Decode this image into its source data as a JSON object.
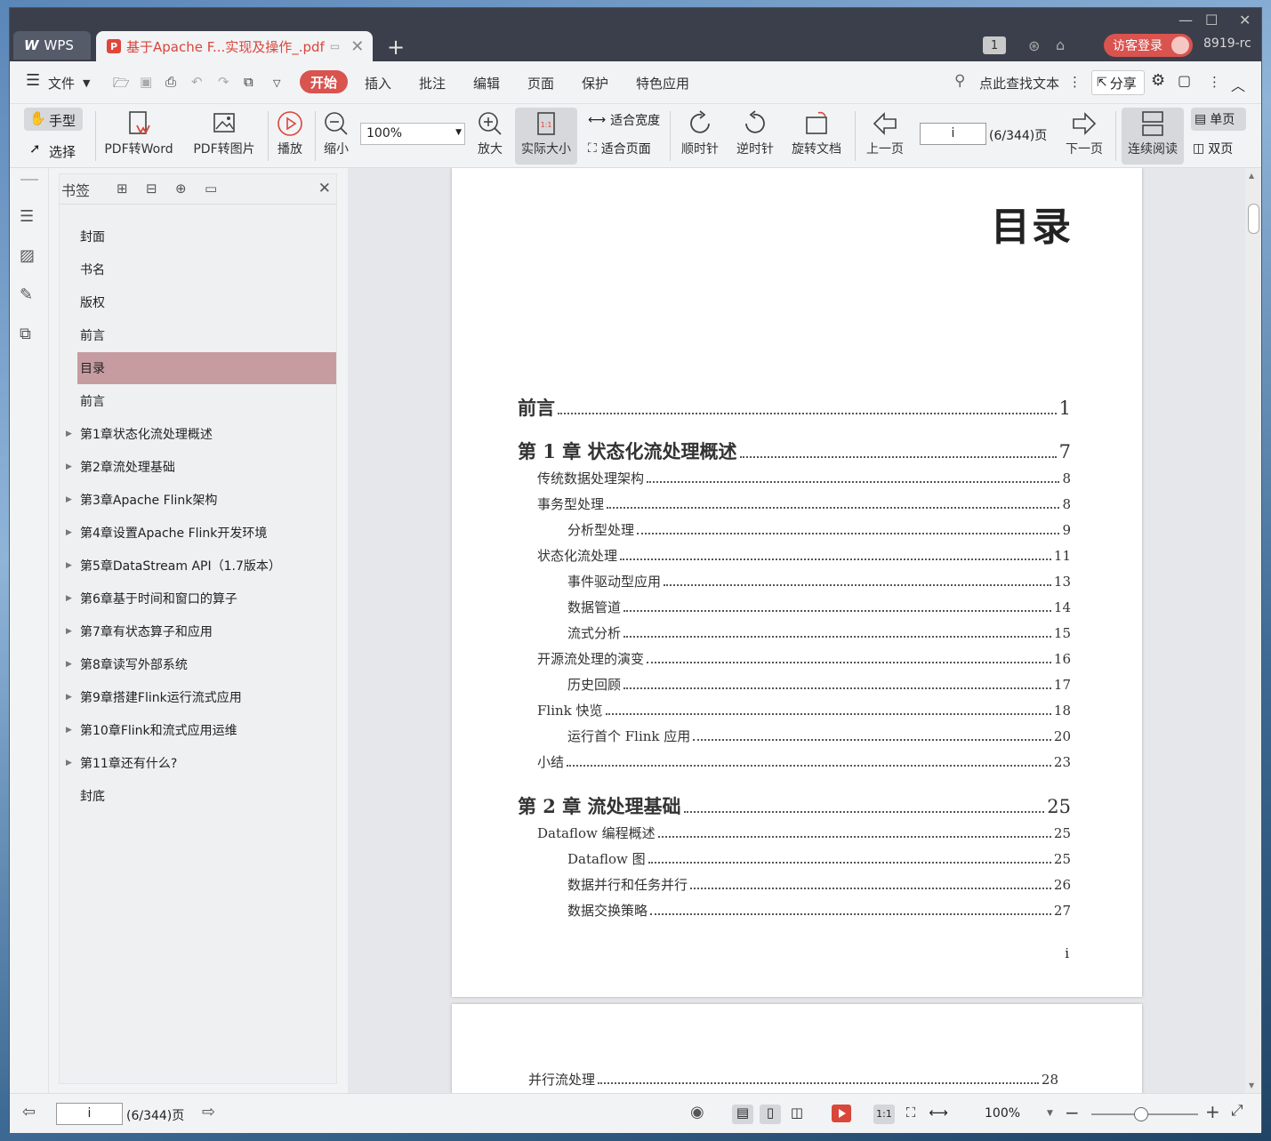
{
  "titlebar": {
    "app_tab": "WPS",
    "doc_tab": "基于Apache F...实现及操作_.pdf",
    "badge": "1",
    "visitor": "访客登录",
    "user": "8919-rc"
  },
  "menu": {
    "file": "文件",
    "start": "开始",
    "insert": "插入",
    "annotate": "批注",
    "edit": "编辑",
    "page": "页面",
    "protect": "保护",
    "special": "特色应用",
    "search": "点此查找文本",
    "share": "分享"
  },
  "ribbon": {
    "hand": "手型",
    "select": "选择",
    "pdf_word": "PDF转Word",
    "pdf_img": "PDF转图片",
    "play": "播放",
    "zoom_out": "缩小",
    "zoom_value": "100%",
    "zoom_in": "放大",
    "actual": "实际大小",
    "fit_width": "适合宽度",
    "fit_page": "适合页面",
    "cw": "顺时针",
    "ccw": "逆时针",
    "rotate": "旋转文档",
    "prev": "上一页",
    "page_input": "i",
    "page_count": "(6/344)页",
    "next": "下一页",
    "continuous": "连续阅读",
    "single": "单页",
    "double": "双页"
  },
  "bookmarks": {
    "title": "书签",
    "items": [
      {
        "label": "封面",
        "expandable": false
      },
      {
        "label": "书名",
        "expandable": false
      },
      {
        "label": "版权",
        "expandable": false
      },
      {
        "label": "前言",
        "expandable": false
      },
      {
        "label": "目录",
        "expandable": false,
        "active": true
      },
      {
        "label": "前言",
        "expandable": false
      },
      {
        "label": "第1章状态化流处理概述",
        "expandable": true
      },
      {
        "label": "第2章流处理基础",
        "expandable": true
      },
      {
        "label": "第3章Apache Flink架构",
        "expandable": true
      },
      {
        "label": "第4章设置Apache Flink开发环境",
        "expandable": true
      },
      {
        "label": "第5章DataStream API（1.7版本）",
        "expandable": true
      },
      {
        "label": "第6章基于时间和窗口的算子",
        "expandable": true
      },
      {
        "label": "第7章有状态算子和应用",
        "expandable": true
      },
      {
        "label": "第8章读写外部系统",
        "expandable": true
      },
      {
        "label": "第9章搭建Flink运行流式应用",
        "expandable": true
      },
      {
        "label": "第10章Flink和流式应用运维",
        "expandable": true
      },
      {
        "label": "第11章还有什么?",
        "expandable": true
      },
      {
        "label": "封底",
        "expandable": false
      }
    ]
  },
  "document": {
    "toc_title": "目录",
    "entries": [
      {
        "text": "前言",
        "page": "1",
        "level": 1
      },
      {
        "text": "第 1 章  状态化流处理概述",
        "page": "7",
        "level": 1
      },
      {
        "text": "传统数据处理架构",
        "page": "8",
        "level": 2
      },
      {
        "text": "事务型处理",
        "page": "8",
        "level": 2
      },
      {
        "text": "分析型处理",
        "page": "9",
        "level": 3
      },
      {
        "text": "状态化流处理",
        "page": "11",
        "level": 2
      },
      {
        "text": "事件驱动型应用",
        "page": "13",
        "level": 3
      },
      {
        "text": "数据管道",
        "page": "14",
        "level": 3
      },
      {
        "text": "流式分析",
        "page": "15",
        "level": 3
      },
      {
        "text": "开源流处理的演变",
        "page": "16",
        "level": 2
      },
      {
        "text": "历史回顾",
        "page": "17",
        "level": 3
      },
      {
        "text": "Flink 快览",
        "page": "18",
        "level": 2
      },
      {
        "text": "运行首个 Flink 应用",
        "page": "20",
        "level": 3
      },
      {
        "text": "小结",
        "page": "23",
        "level": 2
      },
      {
        "text": "第 2 章  流处理基础",
        "page": "25",
        "level": 1
      },
      {
        "text": "Dataflow 编程概述",
        "page": "25",
        "level": 2
      },
      {
        "text": "Dataflow 图",
        "page": "25",
        "level": 3
      },
      {
        "text": "数据并行和任务并行",
        "page": "26",
        "level": 3
      },
      {
        "text": "数据交换策略",
        "page": "27",
        "level": 3
      }
    ],
    "page_number": "i",
    "next_page_entry": {
      "text": "并行流处理",
      "page": "28"
    }
  },
  "statusbar": {
    "page_input": "i",
    "page_count": "(6/344)页",
    "zoom": "100%"
  }
}
